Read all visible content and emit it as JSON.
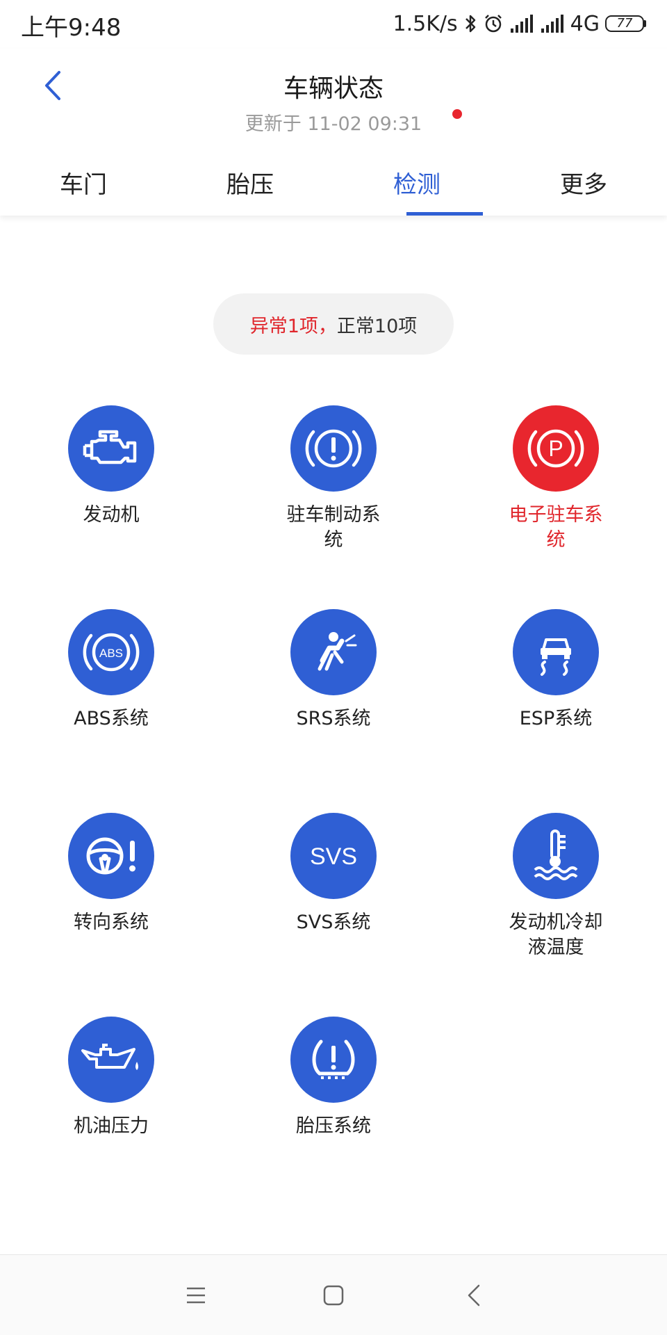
{
  "status_bar": {
    "time": "上午9:48",
    "net_speed": "1.5K/s",
    "network": "4G",
    "battery": "77"
  },
  "header": {
    "title": "车辆状态",
    "updated": "更新于 11-02 09:31"
  },
  "tabs": [
    {
      "label": "车门",
      "active": false
    },
    {
      "label": "胎压",
      "active": false
    },
    {
      "label": "检测",
      "active": true,
      "has_dot": true
    },
    {
      "label": "更多",
      "active": false
    }
  ],
  "summary": {
    "abnormal": "异常1项，",
    "normal": "正常10项"
  },
  "colors": {
    "accent": "#2f5fd4",
    "alert": "#e8262e"
  },
  "items": [
    {
      "icon": "engine-icon",
      "label": "发动机",
      "status": "normal"
    },
    {
      "icon": "brake-warning-icon",
      "label": "驻车制动系统",
      "status": "normal"
    },
    {
      "icon": "parking-brake-icon",
      "label": "电子驻车系统",
      "status": "abnormal"
    },
    {
      "icon": "abs-icon",
      "label": "ABS系统",
      "status": "normal"
    },
    {
      "icon": "airbag-icon",
      "label": "SRS系统",
      "status": "normal"
    },
    {
      "icon": "esp-icon",
      "label": "ESP系统",
      "status": "normal"
    },
    {
      "icon": "steering-warning-icon",
      "label": "转向系统",
      "status": "normal"
    },
    {
      "icon": "svs-icon",
      "label": "SVS系统",
      "status": "normal"
    },
    {
      "icon": "coolant-temperature-icon",
      "label": "发动机冷却液温度",
      "status": "normal"
    },
    {
      "icon": "oil-pressure-icon",
      "label": "机油压力",
      "status": "normal"
    },
    {
      "icon": "tire-pressure-icon",
      "label": "胎压系统",
      "status": "normal"
    }
  ],
  "nav": {
    "icons": [
      "menu-icon",
      "home-icon",
      "back-icon"
    ]
  }
}
